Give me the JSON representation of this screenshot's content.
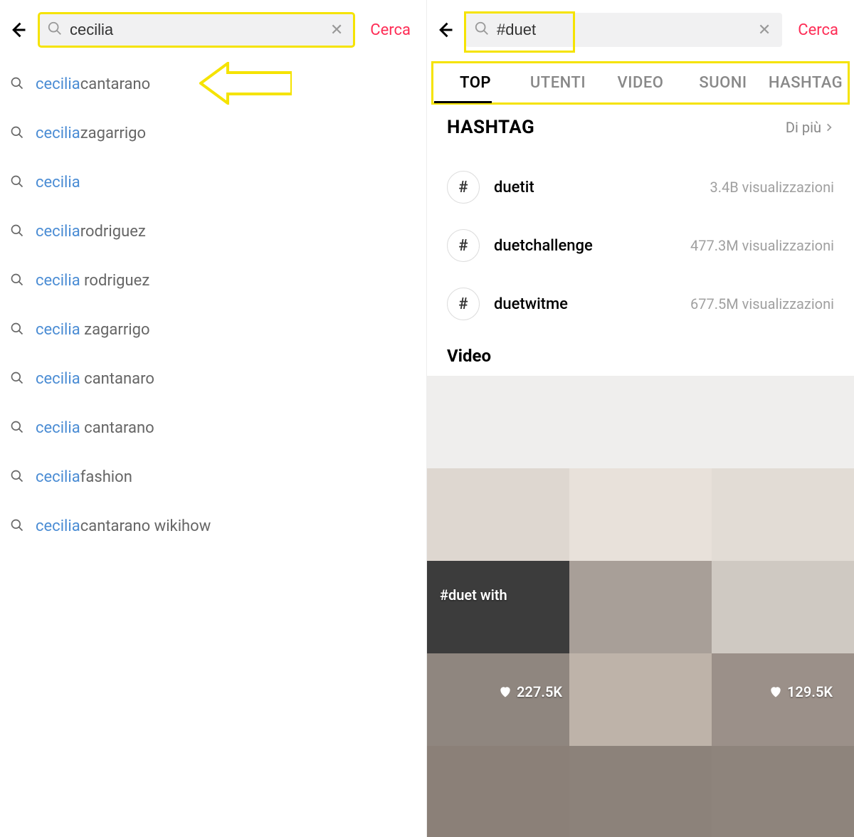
{
  "left": {
    "search_value": "cecilia",
    "cerca_label": "Cerca",
    "suggestions": [
      {
        "match": "cecilia",
        "rest": "cantarano"
      },
      {
        "match": "cecilia",
        "rest": "zagarrigo"
      },
      {
        "match": "cecilia",
        "rest": ""
      },
      {
        "match": "cecilia",
        "rest": "rodriguez"
      },
      {
        "match": "cecilia",
        "rest": " rodriguez"
      },
      {
        "match": "cecilia",
        "rest": " zagarrigo"
      },
      {
        "match": "cecilia",
        "rest": " cantanaro"
      },
      {
        "match": "cecilia",
        "rest": " cantarano"
      },
      {
        "match": "cecilia",
        "rest": "fashion"
      },
      {
        "match": "cecilia",
        "rest": "cantarano wikihow"
      }
    ]
  },
  "right": {
    "search_value": "#duet",
    "cerca_label": "Cerca",
    "tabs": [
      "TOP",
      "UTENTI",
      "VIDEO",
      "SUONI",
      "HASHTAG"
    ],
    "hashtag_section_title": "HASHTAG",
    "more_label": "Di più",
    "hashtag_symbol": "#",
    "hashtags": [
      {
        "name": "duetit",
        "views": "3.4B visualizzazioni"
      },
      {
        "name": "duetchallenge",
        "views": "477.3M visualizzazioni"
      },
      {
        "name": "duetwitme",
        "views": "677.5M visualizzazioni"
      }
    ],
    "video_section_title": "Video",
    "video_overlay_label": "#duet with",
    "video_likes": [
      "227.5K",
      "129.5K"
    ]
  }
}
